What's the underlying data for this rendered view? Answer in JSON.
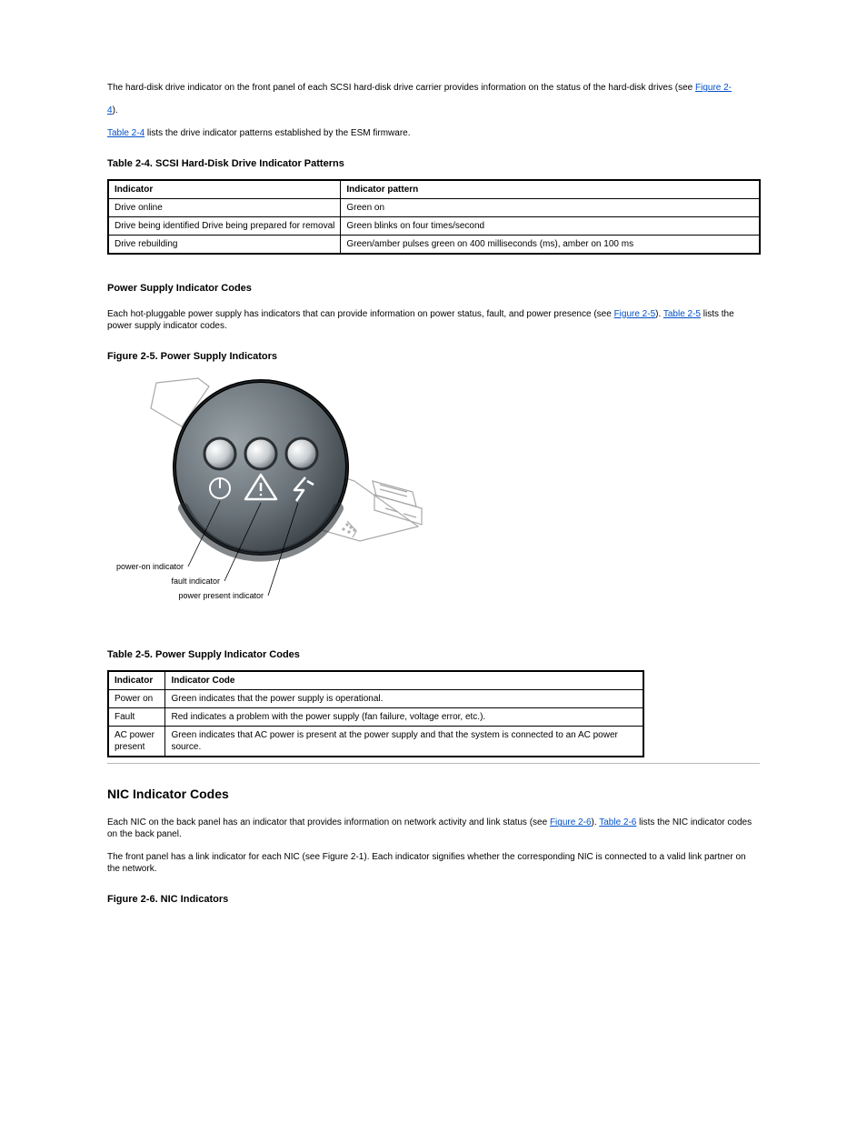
{
  "intro": {
    "p1_a": "The hard-disk drive indicator on the front panel of each SCSI hard-disk drive carrier provides information on the status of the hard-disk drives (see ",
    "link_fig1": "Figure 2-",
    "p1_b": ").",
    "link_dash": "4",
    "p2_a": " lists the drive indicator patterns established by the ESM firmware.",
    "link_tbl1": "Table 2-4"
  },
  "table3": {
    "caption": "Table 2-4. SCSI Hard-Disk Drive Indicator Patterns",
    "h1": "Indicator",
    "h2": "Indicator pattern",
    "r1c1": "Drive online",
    "r1c2": "Green on",
    "r2c1": "Drive being identified Drive being prepared for removal",
    "r2c2": "Green blinks on four times/second",
    "r3c1": "Drive rebuilding",
    "r3c2": "Green/amber pulses green on 400 milliseconds (ms), amber on 100 ms",
    "widths": {
      "full": 719,
      "c1": 45,
      "c2": 674
    }
  },
  "ps_section": {
    "title": "Power Supply Indicator Codes",
    "p1_a": "Each hot-pluggable power supply has indicators that can provide information on power status, fault, and power presence (see ",
    "link_fig2": "Figure 2-5",
    "p1_b": "). ",
    "link_tbl2": "Table 2-5",
    "p1_c": " lists the power supply indicator codes.",
    "fig_caption": "Figure 2-5. Power Supply Indicators"
  },
  "table4": {
    "caption": "Table 2-5. Power Supply Indicator Codes",
    "h1": "Indicator",
    "h2": "Indicator Code",
    "r1c1": "Power on",
    "r1c2": "Green indicates that the power supply is operational.",
    "r2c1": "Fault",
    "r2c2": "Red indicates a problem with the power supply (fan failure, voltage error, etc.).",
    "r3c1": "AC power present",
    "r3c2": "Green indicates that AC power is present at the power supply and that the system is connected to an AC power source.",
    "widths": {
      "full": 591,
      "c1": 63,
      "c2": 528
    }
  },
  "nic_section": {
    "title": "NIC Indicator Codes",
    "p1_a": "Each NIC on the back panel has an indicator that provides information on network activity and link status (see ",
    "link_fig3": "Figure 2-6",
    "p1_b": "). ",
    "link_tbl3": "Table 2-6",
    "p1_c": " lists the NIC indicator codes on the back panel.",
    "p2": "The front panel has a link indicator for each NIC (see Figure 2-1). Each indicator signifies whether the corresponding NIC is connected to a valid link partner on the network.",
    "fig_caption": "Figure 2-6. NIC Indicators"
  },
  "fig_labels": {
    "power_on": "power-on indicator",
    "fault": "fault indicator",
    "power_present": "power present indicator"
  }
}
